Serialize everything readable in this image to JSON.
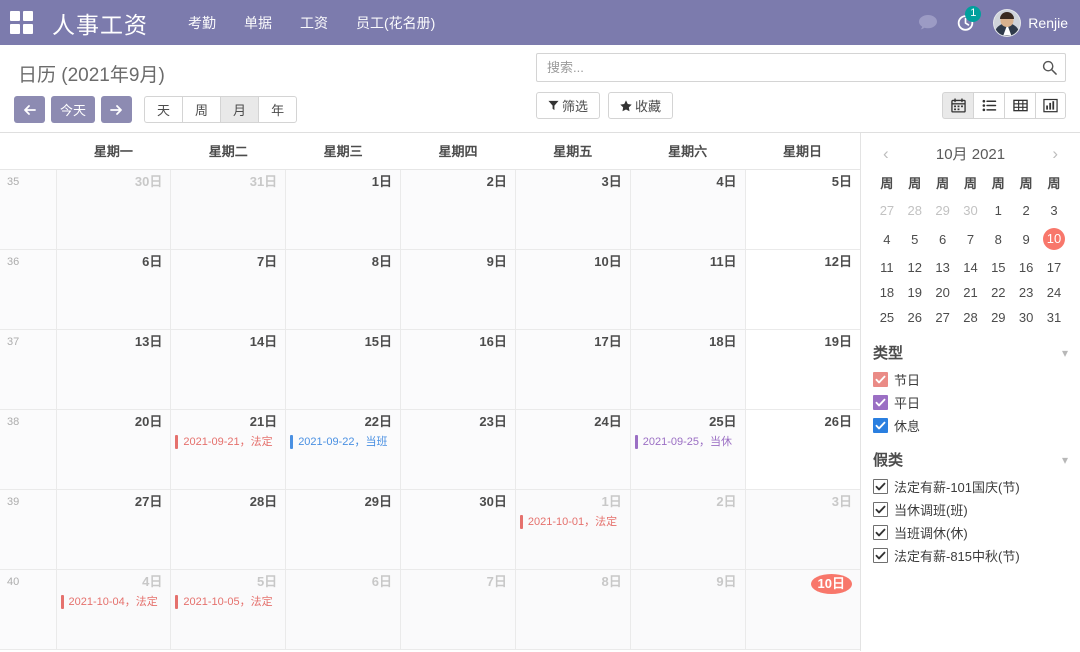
{
  "navbar": {
    "apps_icon": "apps-grid-icon",
    "brand": "人事工资",
    "menu": [
      "考勤",
      "单据",
      "工资",
      "员工(花名册)"
    ],
    "messages_icon": "chat-bubble-icon",
    "activity_icon": "clock-activity-icon",
    "activity_count": "1",
    "user_name": "Renjie",
    "bg_color": "#7c7bad"
  },
  "control_panel": {
    "title": "日历 (2021年9月)",
    "prev_label": "←",
    "today_label": "今天",
    "next_label": "→",
    "scales": [
      {
        "label": "天",
        "active": false
      },
      {
        "label": "周",
        "active": false
      },
      {
        "label": "月",
        "active": true
      },
      {
        "label": "年",
        "active": false
      }
    ],
    "search_placeholder": "搜索...",
    "search_value": "",
    "search_icon": "magnifier-icon",
    "filter_label": "筛选",
    "filter_icon": "funnel-icon",
    "favorite_label": "收藏",
    "favorite_icon": "star-icon",
    "views": [
      {
        "name": "calendar-view",
        "icon": "calendar-icon",
        "active": true
      },
      {
        "name": "list-view",
        "icon": "list-icon",
        "active": false
      },
      {
        "name": "pivot-view",
        "icon": "table-icon",
        "active": false
      },
      {
        "name": "graph-view",
        "icon": "bar-chart-icon",
        "active": false
      }
    ]
  },
  "calendar": {
    "week_header_label": "",
    "weekdays": [
      "星期一",
      "星期二",
      "星期三",
      "星期四",
      "星期五",
      "星期六",
      "星期日"
    ],
    "event_colors": {
      "holiday": "#e5716d",
      "workday": "#4a90e2",
      "rest": "#9b6fc4"
    },
    "rows": [
      {
        "week": "35",
        "days": [
          {
            "num": "30日",
            "muted": true,
            "today": false,
            "events": []
          },
          {
            "num": "31日",
            "muted": true,
            "today": false,
            "events": []
          },
          {
            "num": "1日",
            "muted": false,
            "today": false,
            "events": []
          },
          {
            "num": "2日",
            "muted": false,
            "today": false,
            "events": []
          },
          {
            "num": "3日",
            "muted": false,
            "today": false,
            "events": []
          },
          {
            "num": "4日",
            "muted": false,
            "today": false,
            "events": []
          },
          {
            "num": "5日",
            "muted": false,
            "today": false,
            "events": []
          }
        ]
      },
      {
        "week": "36",
        "days": [
          {
            "num": "6日",
            "muted": false,
            "today": false,
            "events": []
          },
          {
            "num": "7日",
            "muted": false,
            "today": false,
            "events": []
          },
          {
            "num": "8日",
            "muted": false,
            "today": false,
            "events": []
          },
          {
            "num": "9日",
            "muted": false,
            "today": false,
            "events": []
          },
          {
            "num": "10日",
            "muted": false,
            "today": false,
            "events": []
          },
          {
            "num": "11日",
            "muted": false,
            "today": false,
            "events": []
          },
          {
            "num": "12日",
            "muted": false,
            "today": false,
            "events": []
          }
        ]
      },
      {
        "week": "37",
        "days": [
          {
            "num": "13日",
            "muted": false,
            "today": false,
            "events": []
          },
          {
            "num": "14日",
            "muted": false,
            "today": false,
            "events": []
          },
          {
            "num": "15日",
            "muted": false,
            "today": false,
            "events": []
          },
          {
            "num": "16日",
            "muted": false,
            "today": false,
            "events": []
          },
          {
            "num": "17日",
            "muted": false,
            "today": false,
            "events": []
          },
          {
            "num": "18日",
            "muted": false,
            "today": false,
            "events": []
          },
          {
            "num": "19日",
            "muted": false,
            "today": false,
            "events": []
          }
        ]
      },
      {
        "week": "38",
        "days": [
          {
            "num": "20日",
            "muted": false,
            "today": false,
            "events": []
          },
          {
            "num": "21日",
            "muted": false,
            "today": false,
            "events": [
              {
                "text": "2021-09-21，法定",
                "type": "holiday"
              }
            ]
          },
          {
            "num": "22日",
            "muted": false,
            "today": false,
            "events": [
              {
                "text": "2021-09-22，当班",
                "type": "workday"
              }
            ]
          },
          {
            "num": "23日",
            "muted": false,
            "today": false,
            "events": []
          },
          {
            "num": "24日",
            "muted": false,
            "today": false,
            "events": []
          },
          {
            "num": "25日",
            "muted": false,
            "today": false,
            "events": [
              {
                "text": "2021-09-25，当休",
                "type": "rest"
              }
            ]
          },
          {
            "num": "26日",
            "muted": false,
            "today": false,
            "events": []
          }
        ]
      },
      {
        "week": "39",
        "days": [
          {
            "num": "27日",
            "muted": false,
            "today": false,
            "events": []
          },
          {
            "num": "28日",
            "muted": false,
            "today": false,
            "events": []
          },
          {
            "num": "29日",
            "muted": false,
            "today": false,
            "events": []
          },
          {
            "num": "30日",
            "muted": false,
            "today": false,
            "events": []
          },
          {
            "num": "1日",
            "muted": true,
            "today": false,
            "events": [
              {
                "text": "2021-10-01，法定",
                "type": "holiday"
              }
            ]
          },
          {
            "num": "2日",
            "muted": true,
            "today": false,
            "events": []
          },
          {
            "num": "3日",
            "muted": true,
            "today": false,
            "events": []
          }
        ]
      },
      {
        "week": "40",
        "days": [
          {
            "num": "4日",
            "muted": true,
            "today": false,
            "events": [
              {
                "text": "2021-10-04，法定",
                "type": "holiday"
              }
            ]
          },
          {
            "num": "5日",
            "muted": true,
            "today": false,
            "events": [
              {
                "text": "2021-10-05，法定",
                "type": "holiday"
              }
            ]
          },
          {
            "num": "6日",
            "muted": true,
            "today": false,
            "events": []
          },
          {
            "num": "7日",
            "muted": true,
            "today": false,
            "events": []
          },
          {
            "num": "8日",
            "muted": true,
            "today": false,
            "events": []
          },
          {
            "num": "9日",
            "muted": true,
            "today": false,
            "events": []
          },
          {
            "num": "10日",
            "muted": true,
            "today": true,
            "events": []
          }
        ]
      }
    ]
  },
  "mini_calendar": {
    "prev_icon": "chevron-left-icon",
    "next_icon": "chevron-right-icon",
    "title": "10月 2021",
    "weekdays": [
      "周",
      "周",
      "周",
      "周",
      "周",
      "周",
      "周"
    ],
    "weeks": [
      [
        {
          "d": "27",
          "out": true
        },
        {
          "d": "28",
          "out": true
        },
        {
          "d": "29",
          "out": true
        },
        {
          "d": "30",
          "out": true
        },
        {
          "d": "1",
          "out": false
        },
        {
          "d": "2",
          "out": false
        },
        {
          "d": "3",
          "out": false
        }
      ],
      [
        {
          "d": "4",
          "out": false
        },
        {
          "d": "5",
          "out": false
        },
        {
          "d": "6",
          "out": false
        },
        {
          "d": "7",
          "out": false
        },
        {
          "d": "8",
          "out": false
        },
        {
          "d": "9",
          "out": false
        },
        {
          "d": "10",
          "out": false,
          "today": true
        }
      ],
      [
        {
          "d": "11",
          "out": false
        },
        {
          "d": "12",
          "out": false
        },
        {
          "d": "13",
          "out": false
        },
        {
          "d": "14",
          "out": false
        },
        {
          "d": "15",
          "out": false
        },
        {
          "d": "16",
          "out": false
        },
        {
          "d": "17",
          "out": false
        }
      ],
      [
        {
          "d": "18",
          "out": false
        },
        {
          "d": "19",
          "out": false
        },
        {
          "d": "20",
          "out": false
        },
        {
          "d": "21",
          "out": false
        },
        {
          "d": "22",
          "out": false
        },
        {
          "d": "23",
          "out": false
        },
        {
          "d": "24",
          "out": false
        }
      ],
      [
        {
          "d": "25",
          "out": false
        },
        {
          "d": "26",
          "out": false
        },
        {
          "d": "27",
          "out": false
        },
        {
          "d": "28",
          "out": false
        },
        {
          "d": "29",
          "out": false
        },
        {
          "d": "30",
          "out": false
        },
        {
          "d": "31",
          "out": false
        }
      ]
    ]
  },
  "type_filter": {
    "title": "类型",
    "collapse_icon": "chevron-down-icon",
    "items": [
      {
        "label": "节日",
        "checked": true,
        "color": "#ea8b86"
      },
      {
        "label": "平日",
        "checked": true,
        "color": "#9b6fc4"
      },
      {
        "label": "休息",
        "checked": true,
        "color": "#2a7fe0"
      }
    ]
  },
  "leave_filter": {
    "title": "假类",
    "collapse_icon": "chevron-down-icon",
    "items": [
      {
        "label": "法定有薪-101国庆(节)",
        "checked": true
      },
      {
        "label": "当休调班(班)",
        "checked": true
      },
      {
        "label": "当班调休(休)",
        "checked": true
      },
      {
        "label": "法定有薪-815中秋(节)",
        "checked": true
      }
    ]
  }
}
